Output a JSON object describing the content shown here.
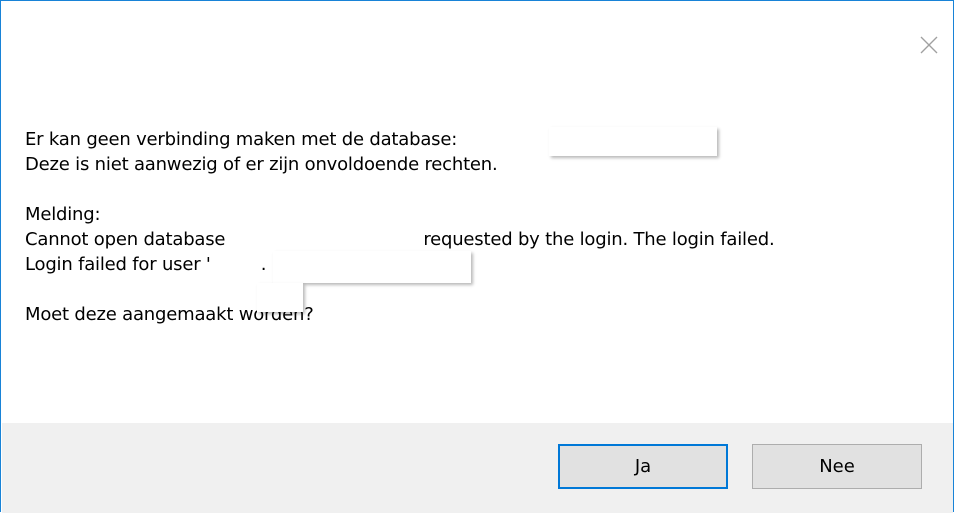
{
  "dialog": {
    "close_icon": "close-icon",
    "message": {
      "line1": "Er kan geen verbinding maken met de database:",
      "line2": "Deze is niet aanwezig of er zijn onvoldoende rechten.",
      "line3": "Melding:",
      "line4_prefix": "Cannot open database",
      "line4_suffix": "requested by the login. The login failed.",
      "line5_prefix": "Login failed for user '",
      "line5_suffix": ".",
      "line6": "Moet deze aangemaakt worden?"
    },
    "buttons": {
      "yes_label": "Ja",
      "no_label": "Nee"
    },
    "colors": {
      "window_border": "#1883d7",
      "footer_background": "#f0f0f0",
      "button_background": "#e1e1e1",
      "default_button_border": "#0078d7"
    }
  }
}
